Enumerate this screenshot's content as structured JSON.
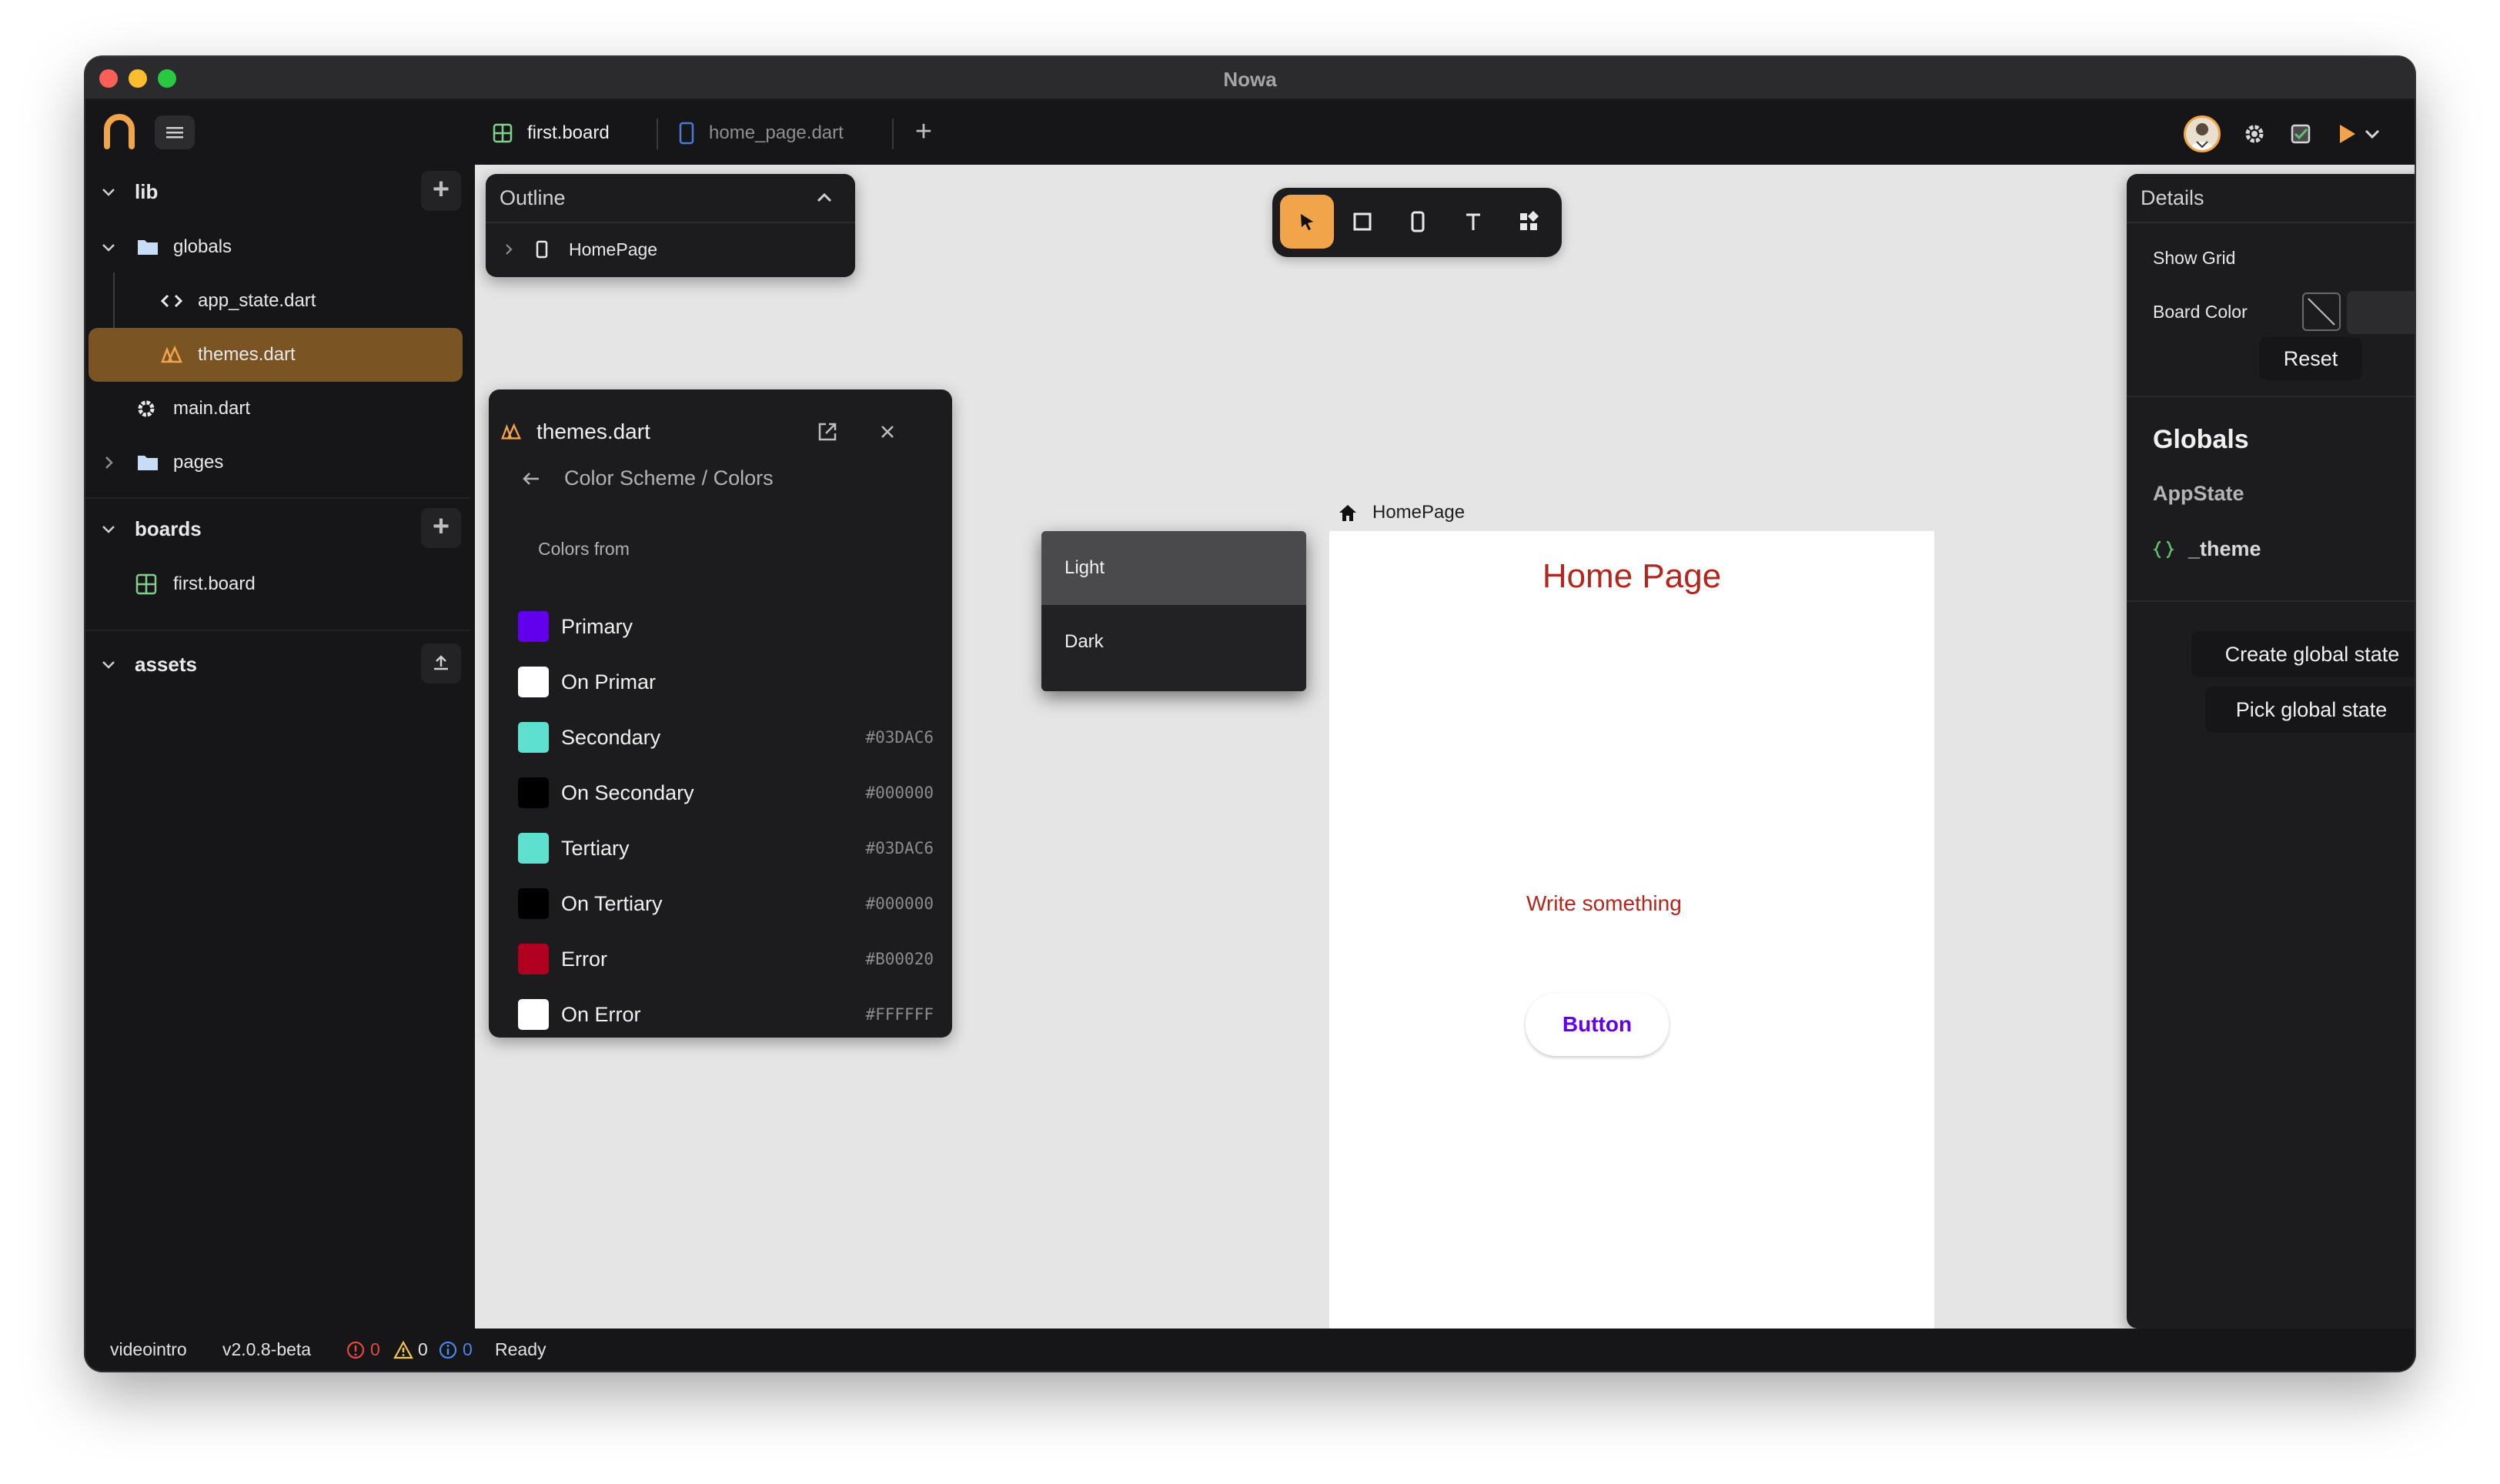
{
  "app": {
    "title": "Nowa"
  },
  "tabs": [
    {
      "label": "first.board",
      "icon": "grid-icon",
      "active": true
    },
    {
      "label": "home_page.dart",
      "icon": "phone-icon",
      "active": false
    }
  ],
  "sidebar": {
    "sections": {
      "lib": "lib",
      "boards": "boards",
      "assets": "assets"
    },
    "items": {
      "globals": "globals",
      "app_state": "app_state.dart",
      "themes": "themes.dart",
      "main": "main.dart",
      "pages": "pages",
      "first_board": "first.board"
    }
  },
  "outline": {
    "title": "Outline",
    "root": "HomePage"
  },
  "themes_panel": {
    "title": "themes.dart",
    "breadcrumb": "Color Scheme / Colors",
    "colors_from_label": "Colors from",
    "colors": [
      {
        "name": "Primary",
        "hex": "",
        "color": "#6200ee"
      },
      {
        "name": "On Primar",
        "hex": "",
        "color": "#ffffff"
      },
      {
        "name": "Secondary",
        "hex": "#03DAC6",
        "color": "#5ee0cf"
      },
      {
        "name": "On Secondary",
        "hex": "#000000",
        "color": "#000000"
      },
      {
        "name": "Tertiary",
        "hex": "#03DAC6",
        "color": "#5ee0cf"
      },
      {
        "name": "On Tertiary",
        "hex": "#000000",
        "color": "#000000"
      },
      {
        "name": "Error",
        "hex": "#B00020",
        "color": "#b00020"
      },
      {
        "name": "On Error",
        "hex": "#FFFFFF",
        "color": "#ffffff"
      }
    ],
    "dropdown": {
      "options": [
        "Light",
        "Dark"
      ],
      "highlighted": "Light"
    }
  },
  "canvas": {
    "page_label": "HomePage",
    "phone": {
      "title": "Home Page",
      "text": "Write something",
      "button": "Button"
    }
  },
  "details": {
    "title": "Details",
    "show_grid_label": "Show Grid",
    "show_grid": false,
    "board_color_label": "Board Color",
    "reset_label": "Reset",
    "globals_title": "Globals",
    "appstate_label": "AppState",
    "theme_var": "_theme",
    "create_global_state": "Create global state",
    "pick_global_state": "Pick global state"
  },
  "status": {
    "project": "videointro",
    "version": "v2.0.8-beta",
    "errors": "0",
    "warnings": "0",
    "infos": "0",
    "state": "Ready"
  },
  "colors": {
    "accent": "#f2a44b",
    "selected_row": "#7b5424",
    "error_text": "#b3261e",
    "button_text": "#6200ee"
  }
}
